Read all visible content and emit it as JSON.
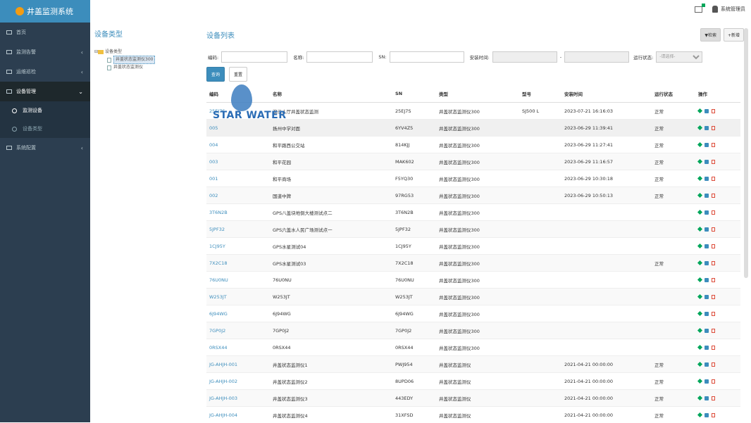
{
  "app": {
    "title": "井盖监测系统"
  },
  "sidebar": {
    "items": [
      {
        "label": "首页",
        "icon": "dashboard-icon",
        "caret": ""
      },
      {
        "label": "监测告警",
        "icon": "alarm-icon",
        "caret": "‹"
      },
      {
        "label": "运维巡检",
        "icon": "inspect-icon",
        "caret": "‹"
      },
      {
        "label": "设备管理",
        "icon": "device-icon",
        "caret": "⌄"
      },
      {
        "label": "系统配置",
        "icon": "settings-icon",
        "caret": "‹"
      }
    ],
    "submenu": [
      {
        "label": "监测设备"
      },
      {
        "label": "设备类型"
      }
    ]
  },
  "topbar": {
    "user": "系统管理员"
  },
  "tree": {
    "title": "设备类型",
    "root": "设备类型",
    "children": [
      "井盖状态监测仪300",
      "井盖状态监测仪"
    ]
  },
  "list": {
    "title": "设备列表",
    "filter_btn": "▼检索",
    "add_btn": "+新增",
    "search": {
      "code_label": "编码:",
      "name_label": "名称:",
      "sn_label": "SN:",
      "time_label": "安装时间:",
      "state_label": "运行状态:",
      "state_placeholder": "-请选择-",
      "query_btn": "查询",
      "reset_btn": "重置"
    },
    "columns": [
      "编码",
      "名称",
      "SN",
      "类型",
      "型号",
      "安装时间",
      "运行状态",
      "操作"
    ],
    "rows": [
      [
        "25EJ7S",
        "演示人厅井盖状态监测",
        "25EJ7S",
        "井盖状态监测仪300",
        "SJ500 L",
        "2023-07-21 16:16:03",
        "正常"
      ],
      [
        "005",
        "扬州中学对面",
        "6YV4Z5",
        "井盖状态监测仪300",
        "",
        "2023-06-29 11:39:41",
        "正常"
      ],
      [
        "004",
        "和平路西公交站",
        "814KJJ",
        "井盖状态监测仪300",
        "",
        "2023-06-29 11:27:41",
        "正常"
      ],
      [
        "003",
        "和平花园",
        "MAK602",
        "井盖状态监测仪300",
        "",
        "2023-06-29 11:16:57",
        "正常"
      ],
      [
        "001",
        "和平商场",
        "F5YQ30",
        "井盖状态监测仪300",
        "",
        "2023-06-29 10:30:18",
        "正常"
      ],
      [
        "002",
        "国道中牌",
        "97RG53",
        "井盖状态监测仪300",
        "",
        "2023-06-29 10:50:13",
        "正常"
      ],
      [
        "3T6N2B",
        "GPS八盖块地倒大楼测试点二",
        "3T6N2B",
        "井盖状态监测仪300",
        "",
        "",
        ""
      ],
      [
        "5JPF32",
        "GPS六盖水人民广场测试点一",
        "5JPF32",
        "井盖状态监测仪300",
        "",
        "",
        ""
      ],
      [
        "1CJ95Y",
        "GPS水星测试04",
        "1CJ95Y",
        "井盖状态监测仪300",
        "",
        "",
        ""
      ],
      [
        "7X2C18",
        "GPS水星测试03",
        "7X2C18",
        "井盖状态监测仪300",
        "",
        "",
        "正常"
      ],
      [
        "76U0NU",
        "76U0NU",
        "76U0NU",
        "井盖状态监测仪300",
        "",
        "",
        ""
      ],
      [
        "W253JT",
        "W253JT",
        "W253JT",
        "井盖状态监测仪300",
        "",
        "",
        ""
      ],
      [
        "6J94WG",
        "6J94WG",
        "6J94WG",
        "井盖状态监测仪300",
        "",
        "",
        ""
      ],
      [
        "7GP0J2",
        "7GP0J2",
        "7GP0J2",
        "井盖状态监测仪300",
        "",
        "",
        ""
      ],
      [
        "0RSX44",
        "0RSX44",
        "0RSX44",
        "井盖状态监测仪300",
        "",
        "",
        ""
      ],
      [
        "JG-AHJH-001",
        "井盖状态监测仪1",
        "PWJ954",
        "井盖状态监测仪",
        "",
        "2021-04-21 00:00:00",
        "正常"
      ],
      [
        "JG-AHJH-002",
        "井盖状态监测仪2",
        "8UPD06",
        "井盖状态监测仪",
        "",
        "2021-04-21 00:00:00",
        "正常"
      ],
      [
        "JG-AHJH-003",
        "井盖状态监测仪3",
        "443EDY",
        "井盖状态监测仪",
        "",
        "2021-04-21 00:00:00",
        "正常"
      ],
      [
        "JG-AHJH-004",
        "井盖状态监测仪4",
        "31XFSD",
        "井盖状态监测仪",
        "",
        "2021-04-21 00:00:00",
        "正常"
      ]
    ]
  },
  "watermark": {
    "text": "STAR WATER"
  },
  "colors": {
    "sidebar": "#2c3e50",
    "brand": "#3c8dbc",
    "link": "#3c8dbc",
    "edit": "#00a65a",
    "delete": "#dd4b39"
  }
}
